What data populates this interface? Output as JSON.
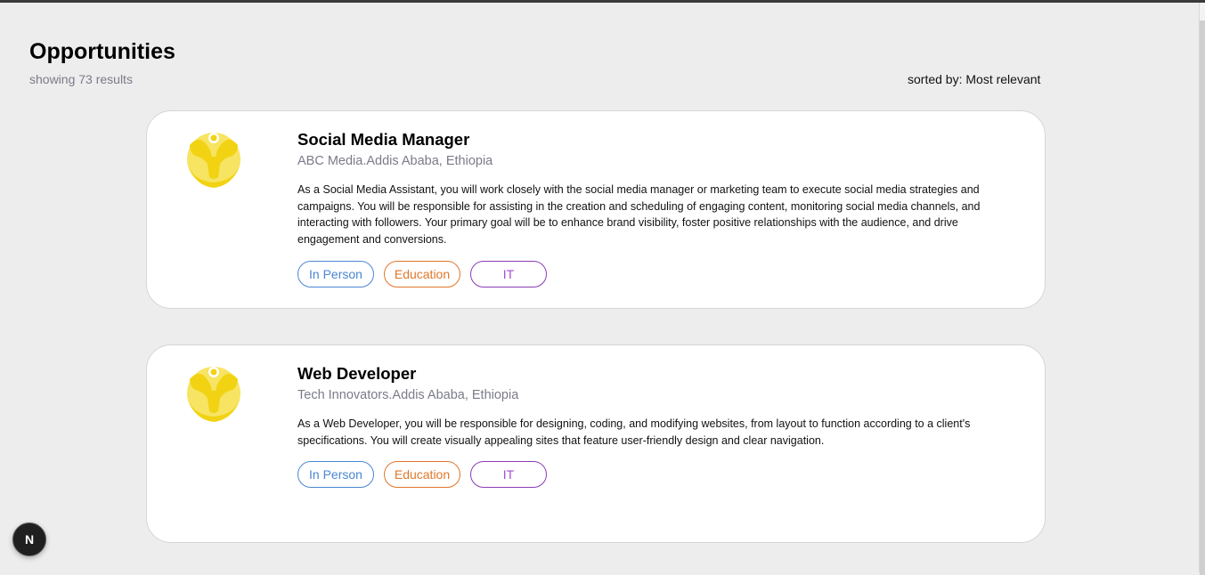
{
  "header": {
    "title": "Opportunities",
    "results": "showing 73 results",
    "sort": "sorted by: Most relevant"
  },
  "colors": {
    "logo_yellow": "#f2d313",
    "tag_blue": "#4a86d4",
    "tag_orange": "#e0772a",
    "tag_purple": "#8a3db5"
  },
  "jobs": [
    {
      "title": "Social Media Manager",
      "company": "ABC Media.Addis Ababa, Ethiopia",
      "description": "As a Social Media Assistant, you will work closely with the social media manager or marketing team to execute social media strategies and campaigns. You will be responsible for assisting in the creation and scheduling of engaging content, monitoring social media channels, and interacting with followers. Your primary goal will be to enhance brand visibility, foster positive relationships with the audience, and drive engagement and conversions.",
      "tags": [
        "In Person",
        "Education",
        "IT"
      ],
      "logo_icon": "company-logo-icon"
    },
    {
      "title": "Web Developer",
      "company": "Tech Innovators.Addis Ababa, Ethiopia",
      "description": "As a Web Developer, you will be responsible for designing, coding, and modifying websites, from layout to function according to a client's specifications. You will create visually appealing sites that feature user-friendly design and clear navigation.",
      "tags": [
        "In Person",
        "Education",
        "IT"
      ],
      "logo_icon": "company-logo-icon"
    }
  ],
  "dev_badge": {
    "label": "N",
    "icon": "nextjs-icon"
  }
}
